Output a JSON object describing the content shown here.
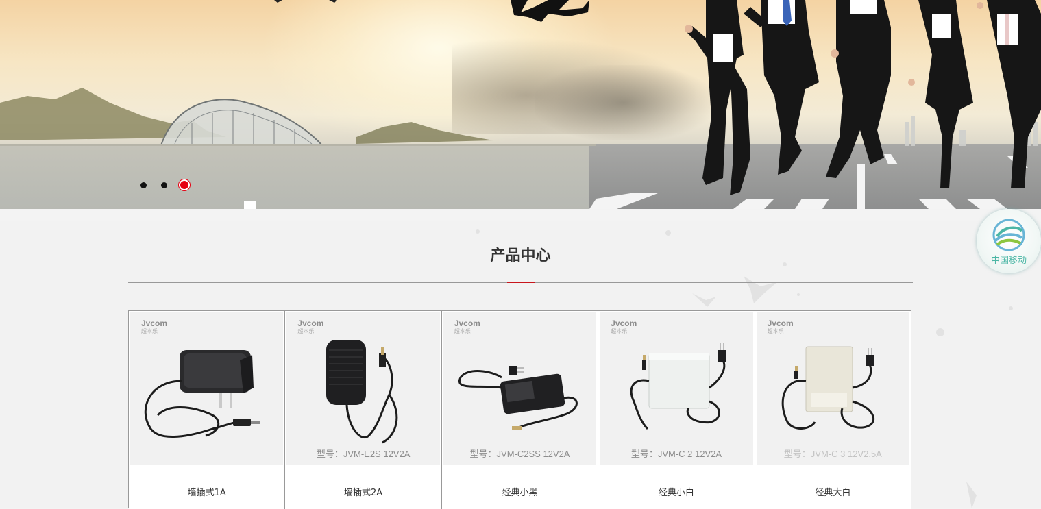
{
  "banner": {
    "slides": [
      "slide-1",
      "slide-2",
      "slide-3"
    ],
    "active_slide": 3,
    "accent_color": "#e60012"
  },
  "badge": {
    "label": "中国移动",
    "icon": "china-mobile-logo",
    "color": "#4bb6a5"
  },
  "products": {
    "title": "产品中心",
    "accent_color": "#c8161d",
    "items": [
      {
        "name": "墙插式1A",
        "brand": "Jvcom",
        "brand_sub": "超本乐",
        "model": "",
        "image": "black-wall-adapter-1a"
      },
      {
        "name": "墙插式2A",
        "brand": "Jvcom",
        "brand_sub": "超本乐",
        "model": "型号：JVM-E2S   12V2A",
        "image": "black-wall-adapter-2a"
      },
      {
        "name": "经典小黑",
        "brand": "Jvcom",
        "brand_sub": "超本乐",
        "model": "型号：JVM-C2SS   12V2A",
        "image": "black-desktop-adapter"
      },
      {
        "name": "经典小白",
        "brand": "Jvcom",
        "brand_sub": "超本乐",
        "model": "型号：JVM-C 2   12V2A",
        "image": "white-box-adapter-small"
      },
      {
        "name": "经典大白",
        "brand": "Jvcom",
        "brand_sub": "超本乐",
        "model": "型号：JVM-C 3   12V2.5A",
        "image": "white-box-adapter-large"
      }
    ]
  }
}
